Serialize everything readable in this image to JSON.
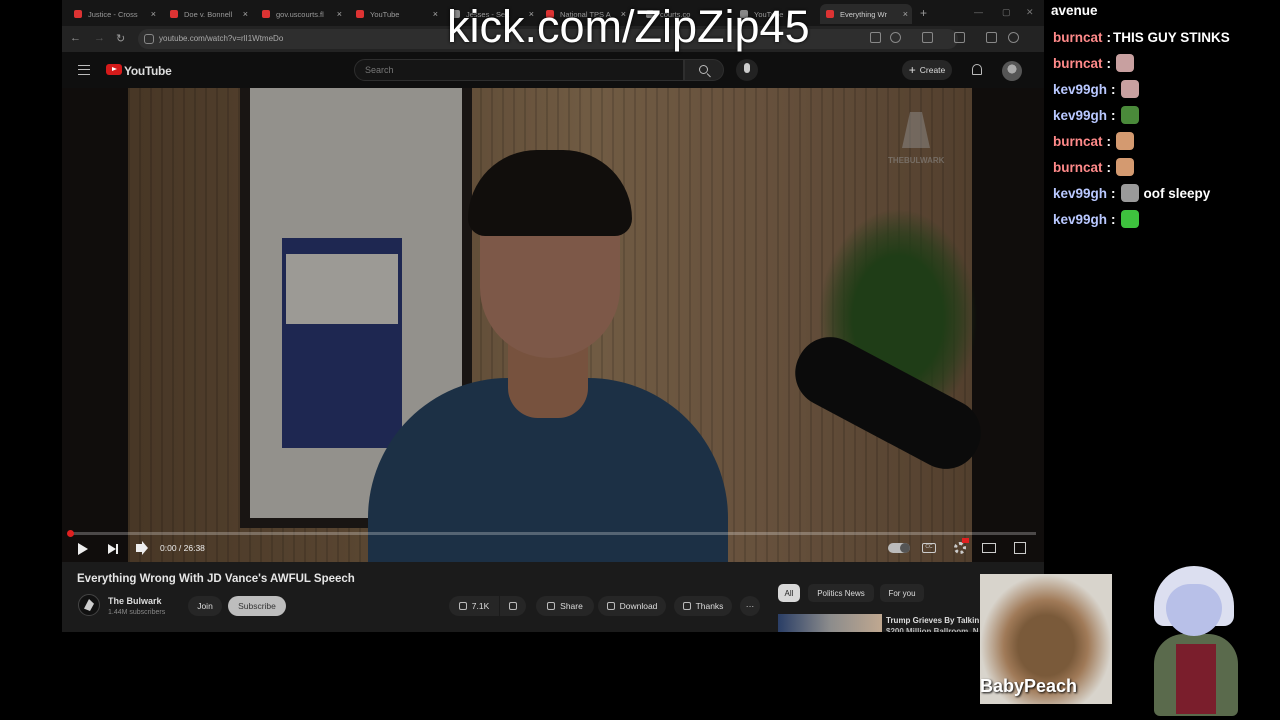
{
  "browser": {
    "tabs": [
      {
        "label": "Justice - Cross",
        "fav_color": "#d33"
      },
      {
        "label": "Doe v. Bonnell",
        "fav_color": "#d33"
      },
      {
        "label": "gov.uscourts.fl",
        "fav_color": "#d33"
      },
      {
        "label": "YouTube",
        "fav_color": "#d33"
      },
      {
        "label": "Jesses - Sea",
        "fav_color": "#888"
      },
      {
        "label": "National TPS A",
        "fav_color": "#d33"
      },
      {
        "label": "courts.co",
        "fav_color": "#888"
      },
      {
        "label": "YouTube",
        "fav_color": "#888"
      },
      {
        "label": "Everything Wr",
        "fav_color": "#d33"
      }
    ],
    "new_tab": "+",
    "url": "youtube.com/watch?v=rlI1WtmeDo"
  },
  "youtube": {
    "logo": "YouTube",
    "search_placeholder": "Search",
    "create_label": "Create",
    "create_plus": "+",
    "watermark": "THEBULWARK",
    "player": {
      "time": "0:00 / 26:38",
      "progress": 0.0
    },
    "video_title": "Everything Wrong With JD Vance's AWFUL Speech",
    "channel": {
      "name": "The Bulwark",
      "subscribers": "1.44M subscribers",
      "join": "Join",
      "subscribe": "Subscribe"
    },
    "actions": {
      "likes": "7.1K",
      "share": "Share",
      "download": "Download",
      "thanks": "Thanks",
      "more": "···"
    },
    "chips": [
      "All",
      "Politics News",
      "For you"
    ],
    "recommendation": {
      "title": "Trump Grieves By Talkin",
      "subtitle": "$200 Million Ballroom, N"
    }
  },
  "overlay": {
    "stream_url": "kick.com/ZipZip45",
    "cam_name": "BabyPeach"
  },
  "chat": {
    "cutoff_text": "avenue",
    "messages": [
      {
        "user": "burncat",
        "color": "#ff8a8a",
        "emote": "",
        "text": "THIS GUY STINKS"
      },
      {
        "user": "burncat",
        "color": "#ff8a8a",
        "emote": "cat-emote",
        "emote_color": "#c8a0a0",
        "text": ""
      },
      {
        "user": "kev99gh",
        "color": "#b9c8ff",
        "emote": "cat-emote",
        "emote_color": "#c8a0a0",
        "text": ""
      },
      {
        "user": "kev99gh",
        "color": "#b9c8ff",
        "emote": "frog-emote",
        "emote_color": "#4a8a3a",
        "text": ""
      },
      {
        "user": "burncat",
        "color": "#ff8a8a",
        "emote": "face-emote",
        "emote_color": "#d49a70",
        "text": ""
      },
      {
        "user": "burncat",
        "color": "#ff8a8a",
        "emote": "face-emote",
        "emote_color": "#d49a70",
        "text": ""
      },
      {
        "user": "kev99gh",
        "color": "#b9c8ff",
        "emote": "sleepy-cat-emote",
        "emote_color": "#9a9a9a",
        "text": "oof sleepy"
      },
      {
        "user": "kev99gh",
        "color": "#b9c8ff",
        "emote": "green-emote",
        "emote_color": "#3ec23e",
        "text": ""
      }
    ]
  }
}
